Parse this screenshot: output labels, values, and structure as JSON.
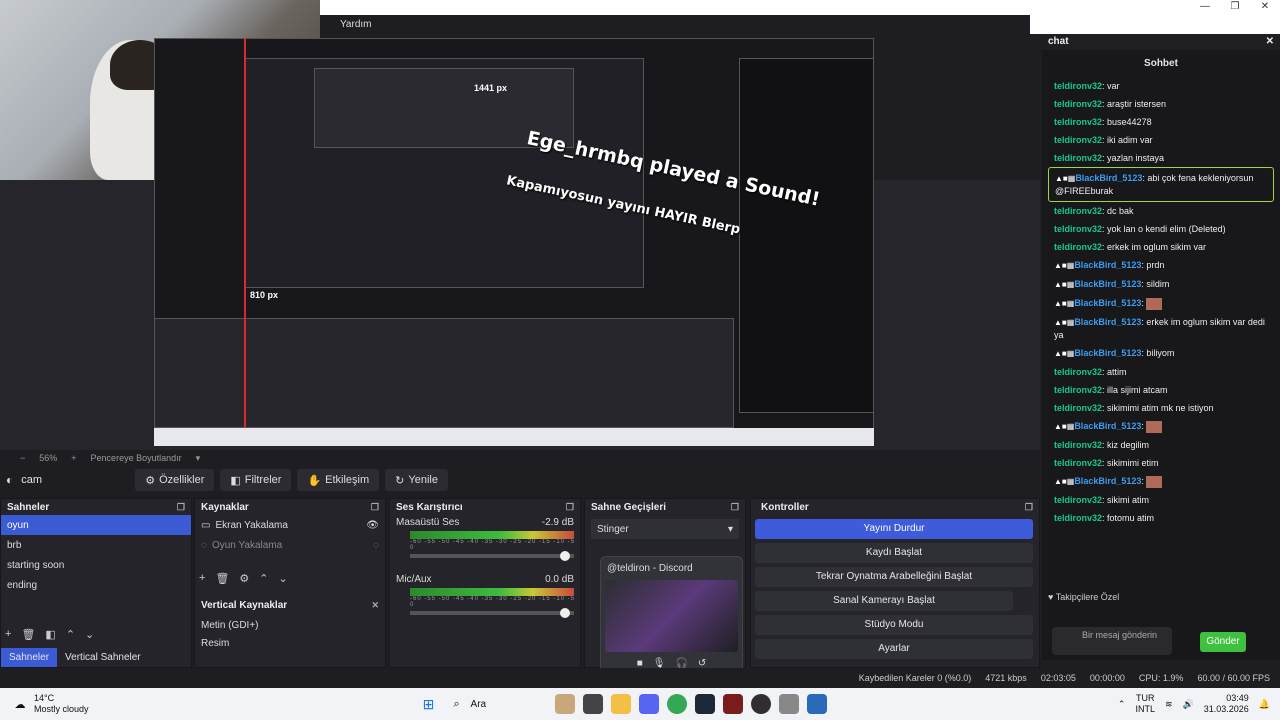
{
  "window": {
    "menu_help": "Yardım"
  },
  "preview": {
    "overlay_lines": [
      "Ege_hrmbq played a Sound!",
      "Kapamıyosun yayını HAYIR Blerp"
    ],
    "size_label_top": "1441 px",
    "size_label_bottom": "810 px"
  },
  "zoombar": {
    "zoom": "56%",
    "fit": "Pencereye Boyutlandır"
  },
  "scene_toolbar": {
    "scene_name": "cam",
    "buttons": [
      "Özellikler",
      "Filtreler",
      "Etkileşim",
      "Yenile"
    ]
  },
  "scenes": {
    "title": "Sahneler",
    "items": [
      "oyun",
      "brb",
      "starting soon",
      "ending"
    ],
    "tabs": [
      "Sahneler",
      "Vertical Sahneler"
    ]
  },
  "sources": {
    "title": "Kaynaklar",
    "items": [
      "Ekran Yakalama",
      "Oyun Yakalama"
    ],
    "vertical_title": "Vertical Kaynaklar",
    "vertical_items": [
      "Metin (GDI+)",
      "Resim"
    ]
  },
  "mixer": {
    "title": "Ses Karıştırıcı",
    "channels": [
      {
        "name": "Masaüstü Ses",
        "db": "-2.9 dB"
      },
      {
        "name": "Mic/Aux",
        "db": "0.0 dB"
      }
    ],
    "scale": "-60 -55 -50 -45 -40 -35 -30 -25 -20 -15 -10 -5 0"
  },
  "transitions": {
    "title": "Sahne Geçişleri",
    "selected": "Stinger"
  },
  "discord": {
    "title": "@teldiron - Discord"
  },
  "controls": {
    "title": "Kontroller",
    "buttons": [
      "Yayını Durdur",
      "Kaydı Başlat",
      "Tekrar Oynatma Arabelleğini Başlat",
      "Sanal Kamerayı Başlat",
      "Stüdyo Modu",
      "Ayarlar"
    ]
  },
  "chat": {
    "title": "chat",
    "header": "Sohbet",
    "messages": [
      {
        "user": "teldironv32",
        "text": "var",
        "kind": "plain"
      },
      {
        "user": "teldironv32",
        "text": "araştir istersen",
        "kind": "plain"
      },
      {
        "user": "teldironv32",
        "text": "buse44278",
        "kind": "plain"
      },
      {
        "user": "teldironv32",
        "text": "iki adim var",
        "kind": "plain"
      },
      {
        "user": "teldironv32",
        "text": "yazlan instaya",
        "kind": "plain"
      },
      {
        "user": "BlackBird_5123",
        "text": "abi çok fena kekleniyorsun @FIREEburak",
        "kind": "highlight"
      },
      {
        "user": "teldironv32",
        "text": "dc bak",
        "kind": "plain"
      },
      {
        "user": "teldironv32",
        "text": "yok lan o kendi elim (Deleted)",
        "kind": "plain"
      },
      {
        "user": "teldironv32",
        "text": "erkek im oglum sikim var",
        "kind": "plain"
      },
      {
        "user": "BlackBird_5123",
        "text": "prdn",
        "kind": "badge"
      },
      {
        "user": "BlackBird_5123",
        "text": "sildim",
        "kind": "badge"
      },
      {
        "user": "BlackBird_5123",
        "text": "",
        "kind": "badge"
      },
      {
        "user": "BlackBird_5123",
        "text": "erkek im oglum sikim var dedi ya",
        "kind": "badge"
      },
      {
        "user": "BlackBird_5123",
        "text": "biliyom",
        "kind": "badge"
      },
      {
        "user": "teldironv32",
        "text": "attim",
        "kind": "plain"
      },
      {
        "user": "teldironv32",
        "text": "illa sijimi atcam",
        "kind": "plain"
      },
      {
        "user": "teldironv32",
        "text": "sikimimi atim mk ne istiyon",
        "kind": "plain"
      },
      {
        "user": "BlackBird_5123",
        "text": "",
        "kind": "badge"
      },
      {
        "user": "teldironv32",
        "text": "kiz degilim",
        "kind": "plain"
      },
      {
        "user": "teldironv32",
        "text": "sikimimi etim",
        "kind": "plain"
      },
      {
        "user": "BlackBird_5123",
        "text": "",
        "kind": "badge"
      },
      {
        "user": "teldironv32",
        "text": "sikimi atim",
        "kind": "plain"
      },
      {
        "user": "teldironv32",
        "text": "fotomu atim",
        "kind": "plain"
      }
    ],
    "private_label": "Takipçilere Özel",
    "input_placeholder": "Bir mesaj gönderin",
    "send_label": "Gönder"
  },
  "statusbar": {
    "dropped": "Kaybedilen Kareler 0 (%0.0)",
    "bitrate": "4721 kbps",
    "stream_time": "02:03:05",
    "rec_time": "00:00:00",
    "cpu": "CPU: 1.9%",
    "fps": "60.00 / 60.00 FPS"
  },
  "taskbar": {
    "weather_temp": "14°C",
    "weather_desc": "Mostly cloudy",
    "search": "Ara",
    "lang1": "TUR",
    "lang2": "INTL",
    "time": "03:49",
    "date": "31.03.2026"
  }
}
